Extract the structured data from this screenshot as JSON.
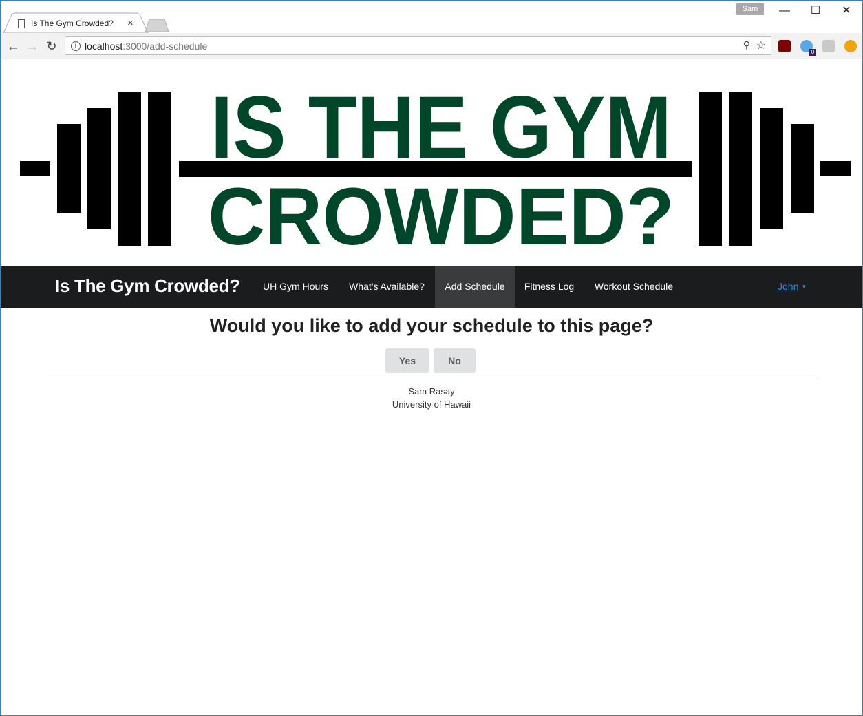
{
  "browser": {
    "tab_title": "Is The Gym Crowded?",
    "tab_close": "×",
    "profile_name": "Sam",
    "window_controls": {
      "minimize": "—",
      "maximize": "☐",
      "close": "✕"
    },
    "url_host": "localhost",
    "url_path": ":3000/add-schedule",
    "ext_badge_count": "0"
  },
  "banner": {
    "line1": "IS THE GYM",
    "line2": "CROWDED?",
    "colors": {
      "text": "#00472a",
      "bars": "#000000"
    }
  },
  "navbar": {
    "brand": "Is The Gym Crowded?",
    "items": [
      {
        "label": "UH Gym Hours",
        "active": false
      },
      {
        "label": "What's Available?",
        "active": false
      },
      {
        "label": "Add Schedule",
        "active": true
      },
      {
        "label": "Fitness Log",
        "active": false
      },
      {
        "label": "Workout Schedule",
        "active": false
      }
    ],
    "user": "John"
  },
  "main": {
    "question": "Would you like to add your schedule to this page?",
    "yes_label": "Yes",
    "no_label": "No"
  },
  "footer": {
    "name": "Sam Rasay",
    "org": "University of Hawaii"
  }
}
